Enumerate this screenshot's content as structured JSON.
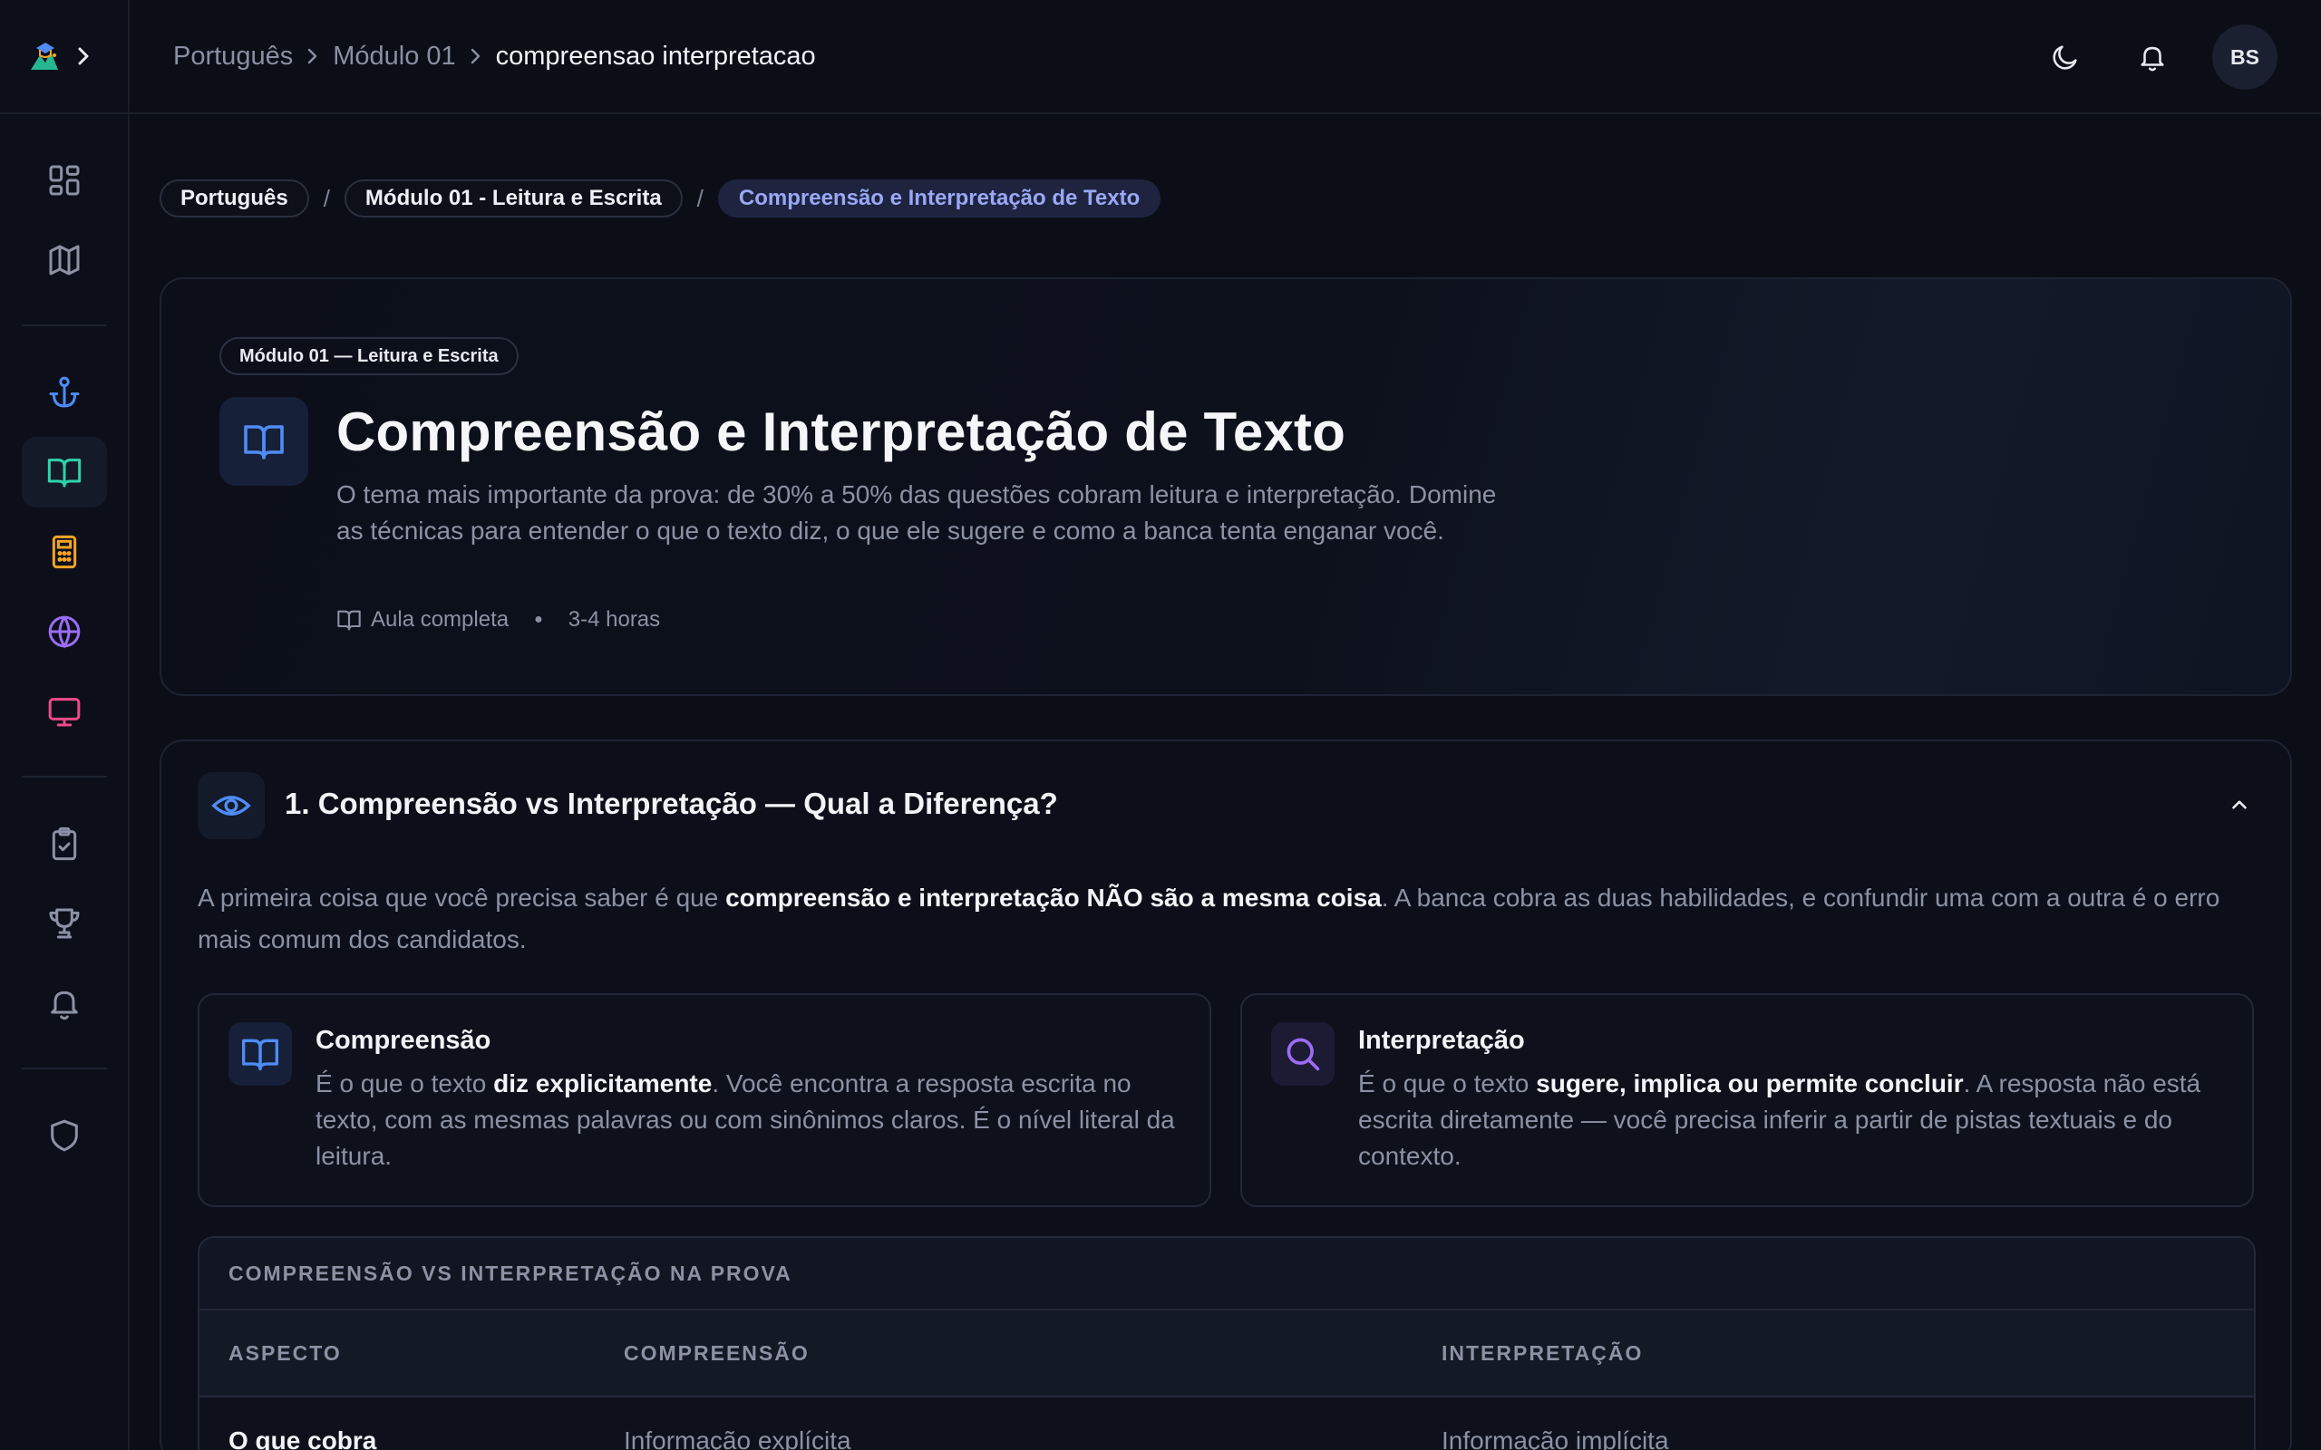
{
  "topbar": {
    "breadcrumb": [
      "Português",
      "Módulo 01",
      "compreensao interpretacao"
    ],
    "avatar_initials": "BS"
  },
  "pill_breadcrumb": {
    "items": [
      "Português",
      "Módulo 01 - Leitura e Escrita",
      "Compreensão e Interpretação de Texto"
    ],
    "separator": "/"
  },
  "hero": {
    "badge": "Módulo 01 — Leitura e Escrita",
    "title": "Compreensão e Interpretação de Texto",
    "description": "O tema mais importante da prova: de 30% a 50% das questões cobram leitura e interpretação. Domine as técnicas para entender o que o texto diz, o que ele sugere e como a banca tenta enganar você.",
    "meta_lesson": "Aula completa",
    "meta_duration": "3-4 horas"
  },
  "section1": {
    "title": "1. Compreensão vs Interpretação — Qual a Diferença?",
    "intro_pre": "A primeira coisa que você precisa saber é que ",
    "intro_bold": "compreensão e interpretação NÃO são a mesma coisa",
    "intro_post": ". A banca cobra as duas habilidades, e confundir uma com a outra é o erro mais comum dos candidatos.",
    "cards": [
      {
        "title": "Compreensão",
        "text_pre": "É o que o texto ",
        "text_bold": "diz explicitamente",
        "text_post": ". Você encontra a resposta escrita no texto, com as mesmas palavras ou com sinônimos claros. É o nível literal da leitura.",
        "icon": "book-open-icon",
        "accent": "#4f8cf7"
      },
      {
        "title": "Interpretação",
        "text_pre": "É o que o texto ",
        "text_bold": "sugere, implica ou permite concluir",
        "text_post": ". A resposta não está escrita diretamente — você precisa inferir a partir de pistas textuais e do contexto.",
        "icon": "search-icon",
        "accent": "#9b6cf5"
      }
    ],
    "table": {
      "caption": "COMPREENSÃO VS INTERPRETAÇÃO NA PROVA",
      "headers": [
        "ASPECTO",
        "COMPREENSÃO",
        "INTERPRETAÇÃO"
      ],
      "rows": [
        [
          "O que cobra",
          "Informação explícita",
          "Informação implícita"
        ]
      ]
    }
  },
  "sidebar": {
    "icons": [
      "dashboard-icon",
      "map-icon",
      "anchor-icon",
      "book-open-icon",
      "calculator-icon",
      "globe-icon",
      "monitor-icon",
      "clipboard-check-icon",
      "trophy-icon",
      "bell-icon",
      "shield-icon"
    ],
    "active": "book-open-icon",
    "colors": {
      "anchor": "#4f8cf7",
      "book": "#2dd4a8",
      "calculator": "#f5a524",
      "globe": "#9b6cf5",
      "monitor": "#f04a8a"
    }
  }
}
